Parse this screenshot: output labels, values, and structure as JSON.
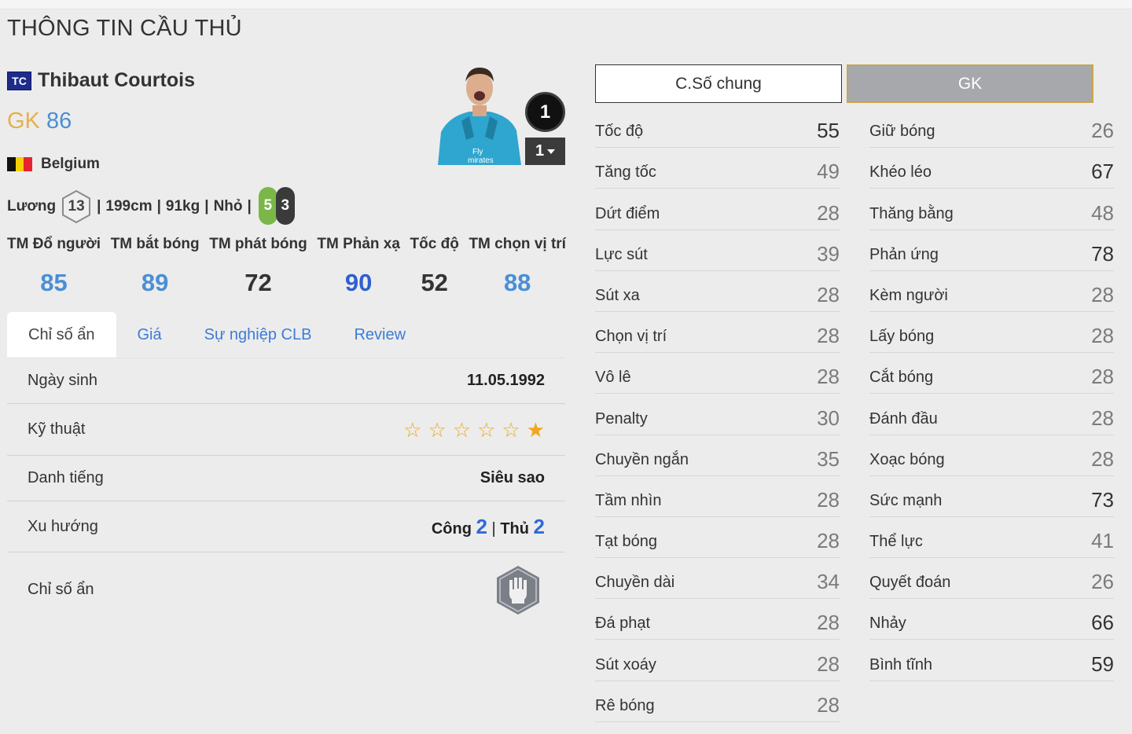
{
  "page_title": "THÔNG TIN CẦU THỦ",
  "player": {
    "season_badge": "TC",
    "name": "Thibaut Courtois",
    "position": "GK",
    "ovr": "86",
    "nation": "Belgium",
    "level": "1",
    "upgrade": "1"
  },
  "info": {
    "salary_label": "Lương",
    "salary": "13",
    "sep": "|",
    "height": "199cm",
    "weight": "91kg",
    "body": "Nhỏ",
    "left_foot": "5",
    "right_foot": "3"
  },
  "summary": [
    {
      "label": "TM Đổ người",
      "value": "85",
      "color": "#4a8fd6"
    },
    {
      "label": "TM bắt bóng",
      "value": "89",
      "color": "#4a8fd6"
    },
    {
      "label": "TM phát bóng",
      "value": "72",
      "color": "#333333"
    },
    {
      "label": "TM Phản xạ",
      "value": "90",
      "color": "#2f5fcf"
    },
    {
      "label": "Tốc độ",
      "value": "52",
      "color": "#333333"
    },
    {
      "label": "TM chọn vị trí",
      "value": "88",
      "color": "#4a8fd6"
    }
  ],
  "tabs": [
    "Chỉ số ẩn",
    "Giá",
    "Sự nghiệp CLB",
    "Review"
  ],
  "details": {
    "birth_label": "Ngày sinh",
    "birth_value": "11.05.1992",
    "skill_label": "Kỹ thuật",
    "skill_stars": 1,
    "fame_label": "Danh tiếng",
    "fame_value": "Siêu sao",
    "trend_label": "Xu hướng",
    "attack_label": "Công",
    "attack_value": "2",
    "defense_label": "Thủ",
    "defense_value": "2",
    "hidden_label": "Chỉ số ẩn",
    "hidden_icon": "goalkeeper-glove-icon"
  },
  "stat_tabs": [
    "C.Số chung",
    "GK"
  ],
  "stats_left": [
    {
      "label": "Tốc độ",
      "value": "55"
    },
    {
      "label": "Tăng tốc",
      "value": "49"
    },
    {
      "label": "Dứt điểm",
      "value": "28"
    },
    {
      "label": "Lực sút",
      "value": "39"
    },
    {
      "label": "Sút xa",
      "value": "28"
    },
    {
      "label": "Chọn vị trí",
      "value": "28"
    },
    {
      "label": "Vô lê",
      "value": "28"
    },
    {
      "label": "Penalty",
      "value": "30"
    },
    {
      "label": "Chuyền ngắn",
      "value": "35"
    },
    {
      "label": "Tầm nhìn",
      "value": "28"
    },
    {
      "label": "Tạt bóng",
      "value": "28"
    },
    {
      "label": "Chuyền dài",
      "value": "34"
    },
    {
      "label": "Đá phạt",
      "value": "28"
    },
    {
      "label": "Sút xoáy",
      "value": "28"
    },
    {
      "label": "Rê bóng",
      "value": "28"
    }
  ],
  "stats_right": [
    {
      "label": "Giữ bóng",
      "value": "26"
    },
    {
      "label": "Khéo léo",
      "value": "67"
    },
    {
      "label": "Thăng bằng",
      "value": "48"
    },
    {
      "label": "Phản ứng",
      "value": "78"
    },
    {
      "label": "Kèm người",
      "value": "28"
    },
    {
      "label": "Lấy bóng",
      "value": "28"
    },
    {
      "label": "Cắt bóng",
      "value": "28"
    },
    {
      "label": "Đánh đầu",
      "value": "28"
    },
    {
      "label": "Xoạc bóng",
      "value": "28"
    },
    {
      "label": "Sức mạnh",
      "value": "73"
    },
    {
      "label": "Thể lực",
      "value": "41"
    },
    {
      "label": "Quyết đoán",
      "value": "26"
    },
    {
      "label": "Nhảy",
      "value": "66"
    },
    {
      "label": "Bình tĩnh",
      "value": "59"
    }
  ]
}
